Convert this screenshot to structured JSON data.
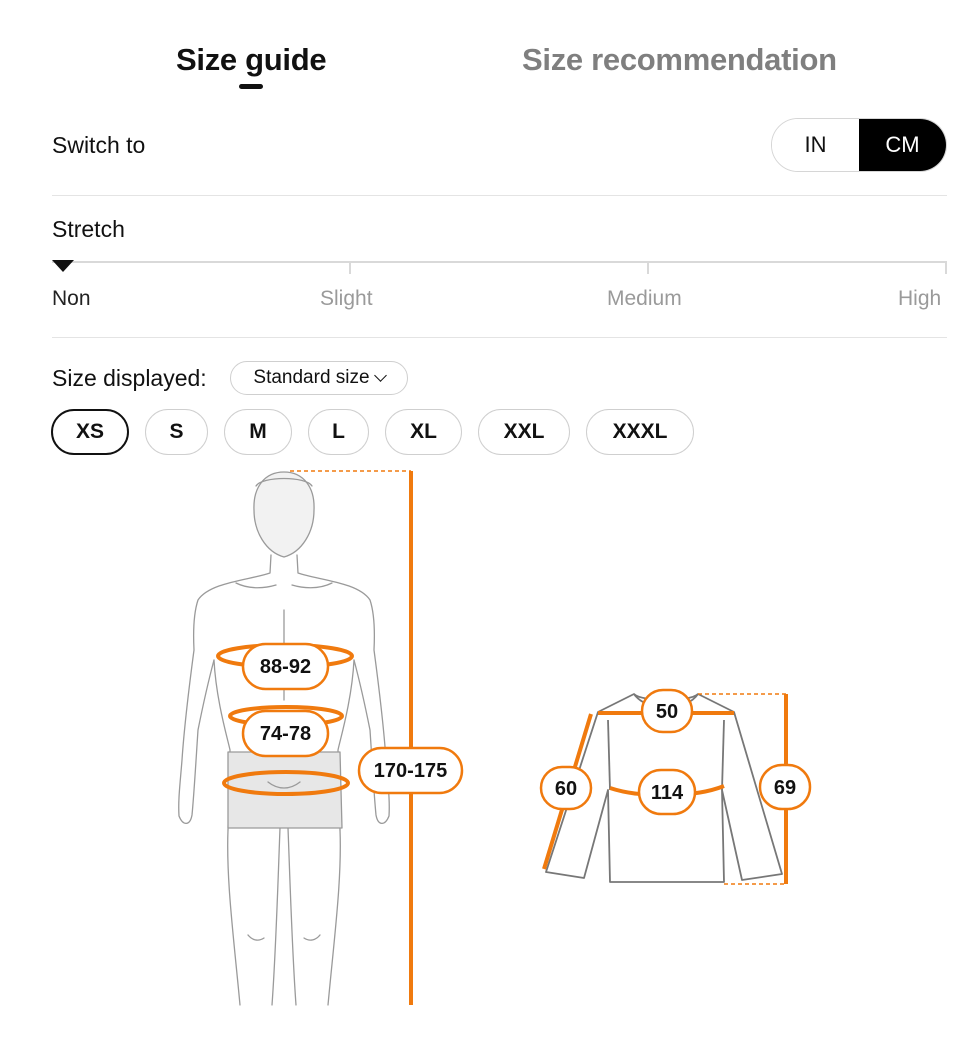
{
  "tabs": [
    {
      "label": "Size guide",
      "active": true
    },
    {
      "label": "Size recommendation",
      "active": false
    }
  ],
  "unit_switch": {
    "label": "Switch to",
    "options": [
      "IN",
      "CM"
    ],
    "selected": "CM"
  },
  "stretch": {
    "title": "Stretch",
    "levels": [
      "Non",
      "Slight",
      "Medium",
      "High"
    ],
    "current": "Non"
  },
  "size_displayed": {
    "label": "Size displayed:",
    "dropdown": "Standard size"
  },
  "sizes": {
    "options": [
      "XS",
      "S",
      "M",
      "L",
      "XL",
      "XXL",
      "XXXL"
    ],
    "selected": "XS"
  },
  "body_measurements": {
    "chest": "88-92",
    "waist": "74-78",
    "height": "170-175"
  },
  "garment_measurements": {
    "shoulder": "50",
    "sleeve": "60",
    "chest": "114",
    "length": "69"
  },
  "colors": {
    "accent": "#F07A0E",
    "selected": "#000000",
    "outline": "#888888"
  }
}
